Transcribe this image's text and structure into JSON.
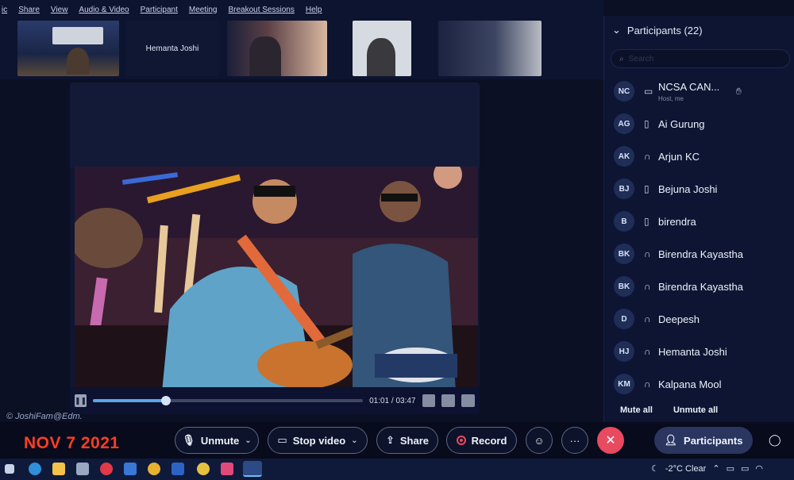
{
  "menu": {
    "items": [
      "ic",
      "Share",
      "View",
      "Audio & Video",
      "Participant",
      "Meeting",
      "Breakout Sessions",
      "Help"
    ]
  },
  "thumbnails": [
    {
      "label": ""
    },
    {
      "label": "Hemanta Joshi"
    },
    {
      "label": ""
    },
    {
      "label": ""
    },
    {
      "label": ""
    }
  ],
  "video": {
    "time_current": "01:01",
    "time_total": "03:47",
    "progress": 0.27
  },
  "panel": {
    "title": "Participants (22)",
    "search_placeholder": "Search",
    "mute_all": "Mute all",
    "unmute_all": "Unmute all",
    "participants": [
      {
        "initials": "NC",
        "name": "NCSA CAN...",
        "sub": "Host, me",
        "device": "video",
        "hand": true
      },
      {
        "initials": "AG",
        "name": "Ai Gurung",
        "sub": "",
        "device": "phone",
        "hand": false
      },
      {
        "initials": "AK",
        "name": "Arjun KC",
        "sub": "",
        "device": "headset",
        "hand": false
      },
      {
        "initials": "BJ",
        "name": "Bejuna Joshi",
        "sub": "",
        "device": "phone",
        "hand": false
      },
      {
        "initials": "B",
        "name": "birendra",
        "sub": "",
        "device": "phone",
        "hand": false
      },
      {
        "initials": "BK",
        "name": "Birendra Kayastha",
        "sub": "",
        "device": "headset",
        "hand": false
      },
      {
        "initials": "BK",
        "name": "Birendra Kayastha",
        "sub": "",
        "device": "headset",
        "hand": false
      },
      {
        "initials": "D",
        "name": "Deepesh",
        "sub": "",
        "device": "headset",
        "hand": false
      },
      {
        "initials": "HJ",
        "name": "Hemanta Joshi",
        "sub": "",
        "device": "headset",
        "hand": false
      },
      {
        "initials": "KM",
        "name": "Kalpana Mool",
        "sub": "",
        "device": "headset",
        "hand": false
      }
    ]
  },
  "toolbar": {
    "unmute": "Unmute",
    "stop_video": "Stop video",
    "share": "Share",
    "record": "Record",
    "more": "···",
    "participants": "Participants"
  },
  "overlay": {
    "watermark": "© JoshiFam@Edm.",
    "date": "NOV 7 2021"
  },
  "taskbar": {
    "weather": "-2°C  Clear"
  }
}
